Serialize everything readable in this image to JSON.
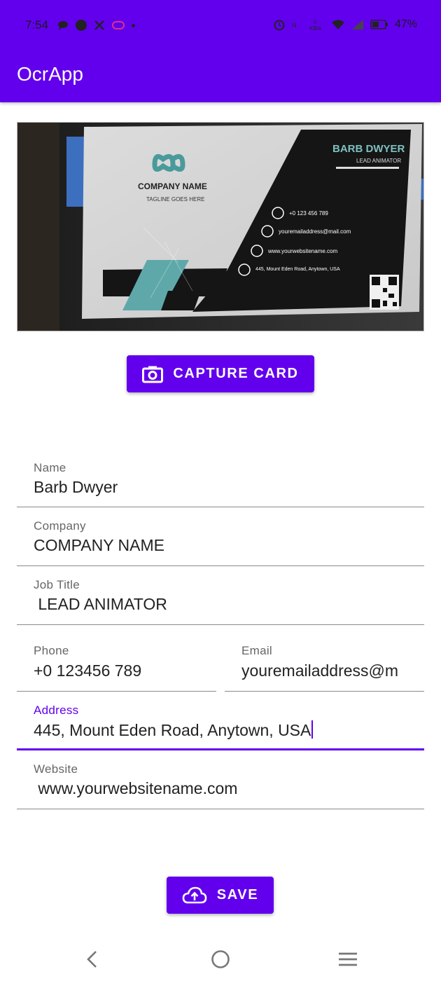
{
  "status_bar": {
    "time": "7:54",
    "battery": "47%"
  },
  "app_bar": {
    "title": "OcrApp"
  },
  "card_image": {
    "company": "COMPANY NAME",
    "tagline": "TAGLINE GOES HERE",
    "name": "BARB DWYER",
    "role": "LEAD ANIMATOR",
    "phone": "+0 123 456 789",
    "email": "youremailaddress@mail.com",
    "website": "www.yourwebsitename.com",
    "address": "445, Mount Eden Road, Anytown, USA"
  },
  "capture_button": {
    "label": "CAPTURE CARD"
  },
  "form": {
    "name": {
      "label": "Name",
      "value": "Barb Dwyer"
    },
    "company": {
      "label": "Company",
      "value": "COMPANY NAME"
    },
    "job_title": {
      "label": "Job Title",
      "value": " LEAD ANIMATOR"
    },
    "phone": {
      "label": "Phone",
      "value": "+0 123456 789"
    },
    "email": {
      "label": "Email",
      "value": "youremailaddress@m"
    },
    "address": {
      "label": "Address",
      "value": "445, Mount Eden Road, Anytown, USA"
    },
    "website": {
      "label": "Website",
      "value": " www.yourwebsitename.com"
    }
  },
  "save_button": {
    "label": "SAVE"
  },
  "colors": {
    "primary": "#6200ee",
    "teal": "#4a9a9c"
  }
}
